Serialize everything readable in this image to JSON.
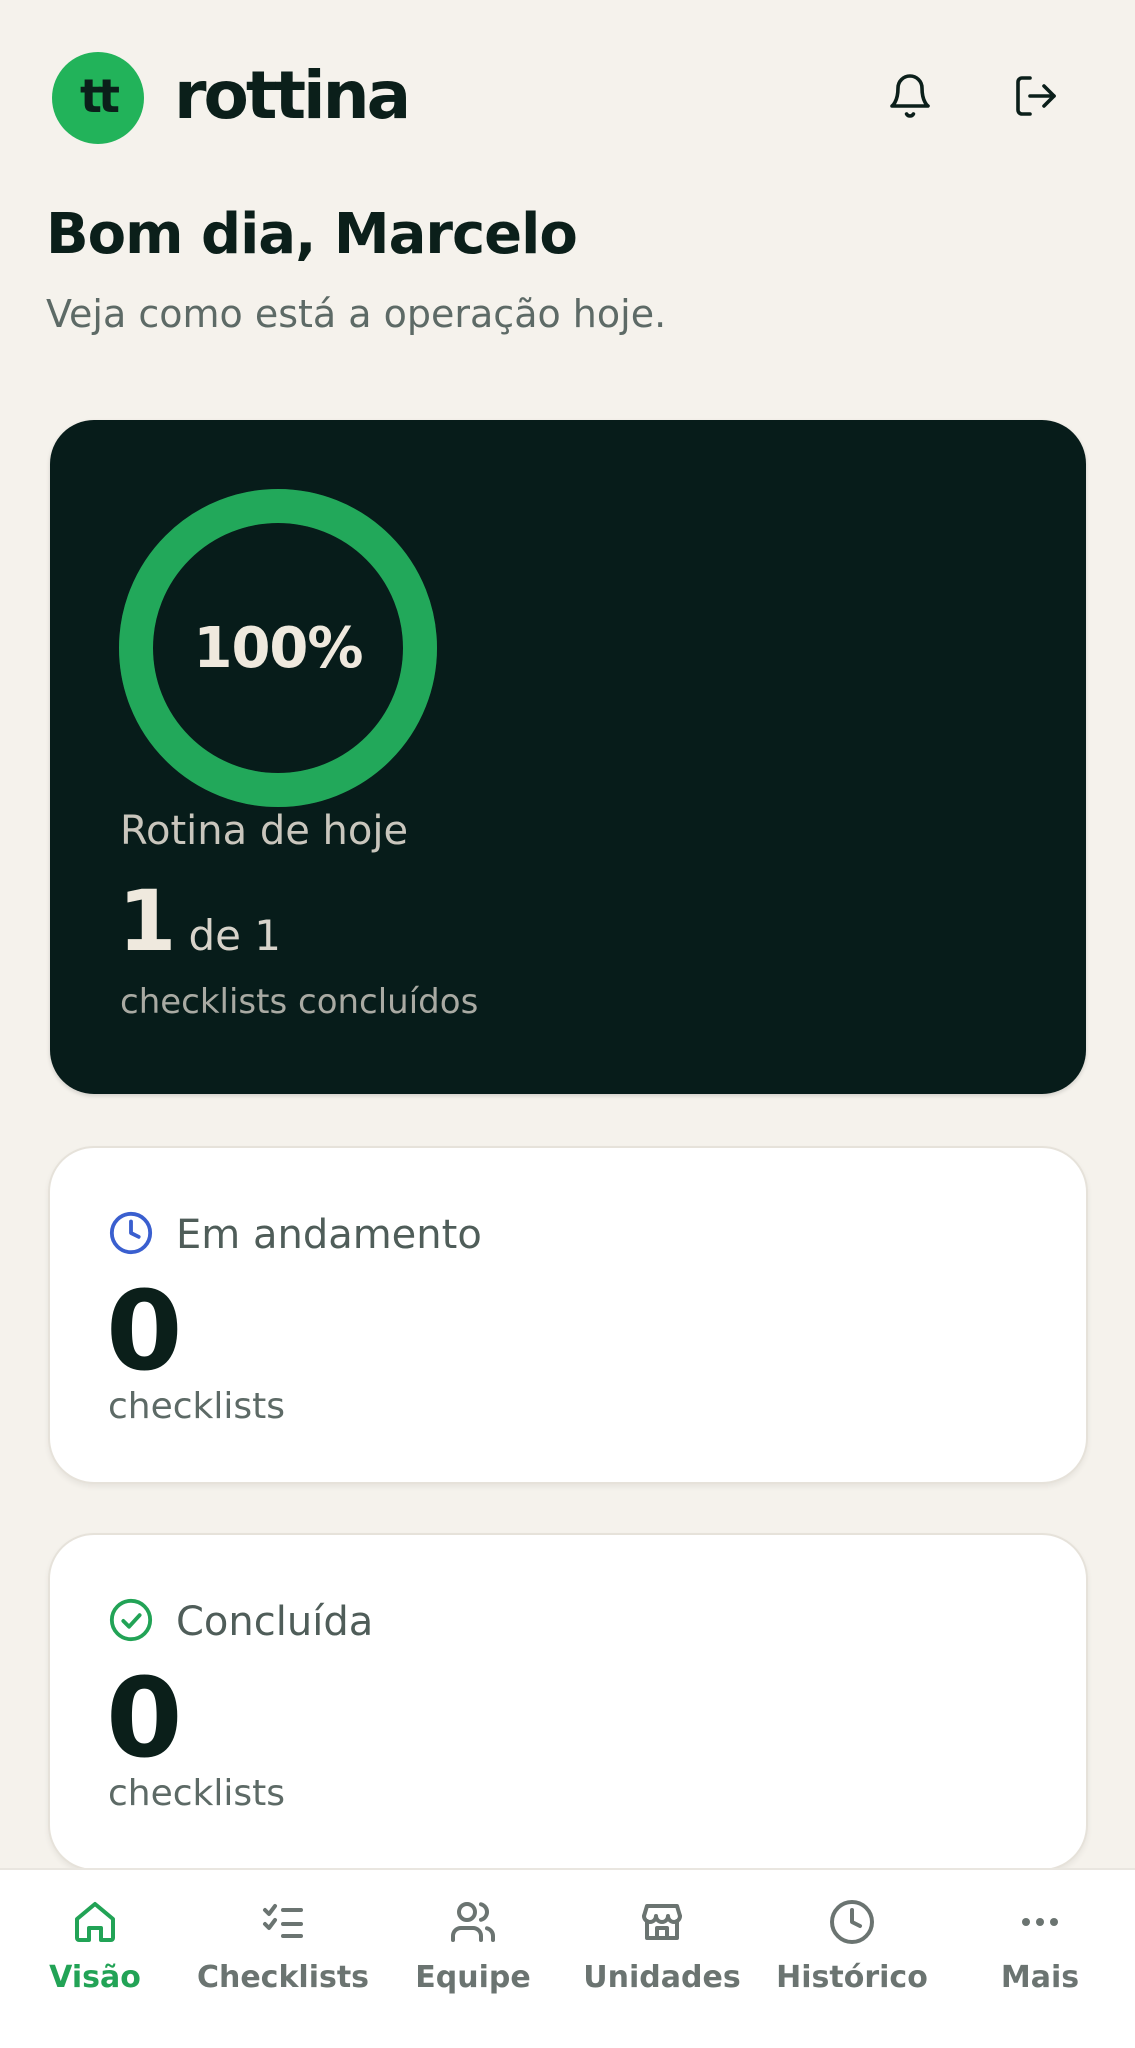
{
  "header": {
    "logo_text": "tt",
    "brand": "rottina",
    "icons": {
      "notifications": "bell-icon",
      "logout": "logout-icon"
    }
  },
  "greeting": {
    "title": "Bom dia, Marcelo",
    "subtitle": "Veja como está a operação hoje."
  },
  "hero": {
    "percent_label": "100%",
    "progress": 1.0,
    "title": "Rotina de hoje",
    "done": "1",
    "of_total": "de 1",
    "caption": "checklists concluídos"
  },
  "cards": [
    {
      "icon": "clock-icon",
      "label": "Em andamento",
      "value": "0",
      "unit": "checklists",
      "icon_color": "#3a5fcf"
    },
    {
      "icon": "check-circle-icon",
      "label": "Concluída",
      "value": "0",
      "unit": "checklists",
      "icon_color": "#22a356"
    }
  ],
  "nav": {
    "items": [
      {
        "label": "Visão",
        "icon": "home-icon",
        "active": true
      },
      {
        "label": "Checklists",
        "icon": "checklist-icon",
        "active": false
      },
      {
        "label": "Equipe",
        "icon": "users-icon",
        "active": false
      },
      {
        "label": "Unidades",
        "icon": "store-icon",
        "active": false
      },
      {
        "label": "Histórico",
        "icon": "history-icon",
        "active": false
      },
      {
        "label": "Mais",
        "icon": "more-icon",
        "active": false
      }
    ]
  },
  "colors": {
    "accent": "#22b35a",
    "hero_bg": "#071c1a",
    "page_bg": "#f5f2ec",
    "nav_active": "#22a356"
  }
}
